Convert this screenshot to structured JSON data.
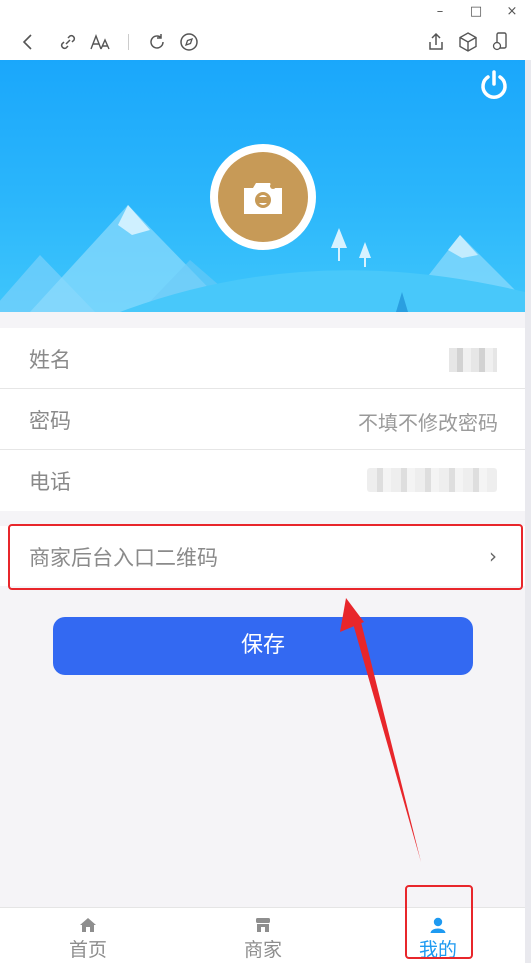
{
  "toolbar": {
    "icons": [
      "back-icon",
      "link-icon",
      "font-size-icon",
      "refresh-icon",
      "compass-icon",
      "share-icon",
      "cube-icon",
      "mobile-icon"
    ]
  },
  "window": {
    "minimize": "–",
    "maximize": "□",
    "close": "×"
  },
  "form": {
    "name_label": "姓名",
    "password_label": "密码",
    "password_placeholder": "不填不修改密码",
    "phone_label": "电话"
  },
  "qr_entry": {
    "label": "商家后台入口二维码",
    "chevron": "›"
  },
  "save_button": "保存",
  "tabs": [
    {
      "label": "首页",
      "icon": "home-icon"
    },
    {
      "label": "商家",
      "icon": "store-icon"
    },
    {
      "label": "我的",
      "icon": "person-icon"
    }
  ],
  "colors": {
    "header": "#1aa7fb",
    "accent": "#3369f2",
    "active_tab": "#1e9af1",
    "highlight": "#e8262b",
    "avatar": "#c79a57"
  }
}
